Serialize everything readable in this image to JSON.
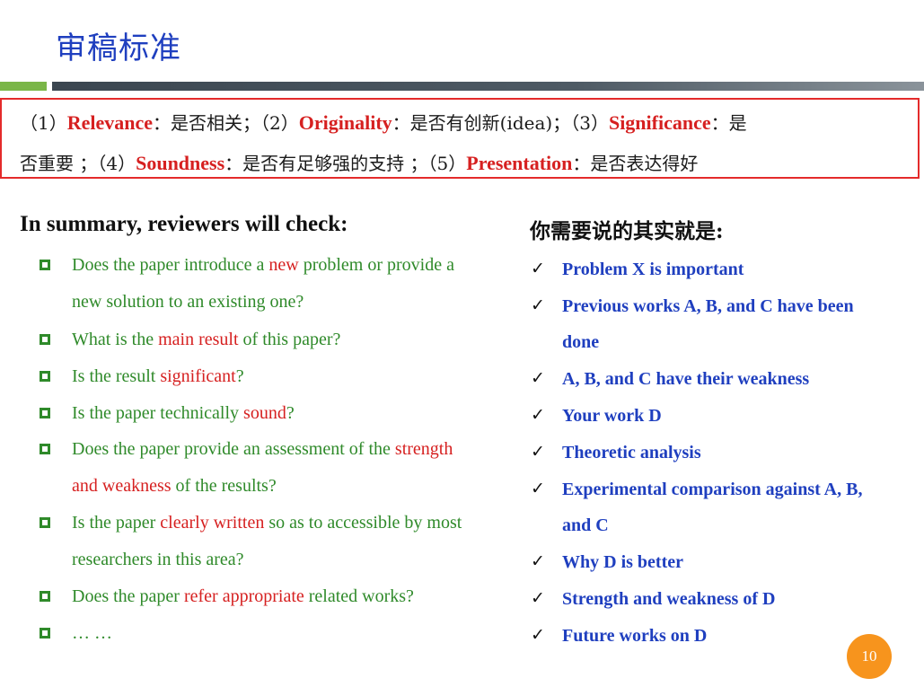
{
  "title": "审稿标准",
  "criteria": {
    "line1": [
      {
        "text": "（1）",
        "kw": false
      },
      {
        "text": "Relevance",
        "kw": true
      },
      {
        "text": "：是否相关；（2）",
        "kw": false
      },
      {
        "text": "Originality",
        "kw": true
      },
      {
        "text": "：是否有创新(idea)；（3）",
        "kw": false
      },
      {
        "text": "Significance",
        "kw": true
      },
      {
        "text": "：是",
        "kw": false
      }
    ],
    "line2": [
      {
        "text": "否重要 ；（4）",
        "kw": false
      },
      {
        "text": "Soundness",
        "kw": true
      },
      {
        "text": "：是否有足够强的支持 ；（5）",
        "kw": false
      },
      {
        "text": "Presentation",
        "kw": true
      },
      {
        "text": "：是否表达得好",
        "kw": false
      }
    ]
  },
  "left_heading": "In summary, reviewers will check:",
  "right_heading": "你需要说的其实就是:",
  "left_items": [
    {
      "bullet": true,
      "parts": [
        {
          "t": "Does the paper introduce a ",
          "r": false
        },
        {
          "t": "new",
          "r": true
        },
        {
          "t": " problem or provide a",
          "r": false
        }
      ]
    },
    {
      "bullet": false,
      "parts": [
        {
          "t": "new solution to an existing one?",
          "r": false
        }
      ]
    },
    {
      "bullet": true,
      "parts": [
        {
          "t": " What is the ",
          "r": false
        },
        {
          "t": "main result",
          "r": true
        },
        {
          "t": " of this paper?",
          "r": false
        }
      ]
    },
    {
      "bullet": true,
      "parts": [
        {
          "t": "Is the result ",
          "r": false
        },
        {
          "t": "significant",
          "r": true
        },
        {
          "t": "?",
          "r": false
        }
      ]
    },
    {
      "bullet": true,
      "parts": [
        {
          "t": "Is the paper technically ",
          "r": false
        },
        {
          "t": "sound",
          "r": true
        },
        {
          "t": "?",
          "r": false
        }
      ]
    },
    {
      "bullet": true,
      "parts": [
        {
          "t": "Does the paper provide an assessment of the ",
          "r": false
        },
        {
          "t": "strength",
          "r": true
        }
      ]
    },
    {
      "bullet": false,
      "parts": [
        {
          "t": "and weakness",
          "r": true
        },
        {
          "t": " of the results?",
          "r": false
        }
      ]
    },
    {
      "bullet": true,
      "parts": [
        {
          "t": "Is the paper ",
          "r": false
        },
        {
          "t": "clearly written",
          "r": true
        },
        {
          "t": " so as to accessible by most",
          "r": false
        }
      ]
    },
    {
      "bullet": false,
      "parts": [
        {
          "t": "researchers in this area?",
          "r": false
        }
      ]
    },
    {
      "bullet": true,
      "parts": [
        {
          "t": "Does the paper ",
          "r": false
        },
        {
          "t": "refer appropriate",
          "r": true
        },
        {
          "t": " related works?",
          "r": false
        }
      ]
    },
    {
      "bullet": true,
      "parts": [
        {
          "t": "… …",
          "r": false
        }
      ]
    }
  ],
  "check_symbol": "✓",
  "right_items": [
    {
      "check": true,
      "text": "Problem X is important"
    },
    {
      "check": true,
      "text": "Previous works A, B, and C have been"
    },
    {
      "check": false,
      "text": "done"
    },
    {
      "check": true,
      "text": " A, B, and C have their weakness"
    },
    {
      "check": true,
      "text": "Your work D"
    },
    {
      "check": true,
      "text": "Theoretic analysis"
    },
    {
      "check": true,
      "text": "Experimental comparison against A, B,"
    },
    {
      "check": false,
      "text": "and C"
    },
    {
      "check": true,
      "text": "Why D is better"
    },
    {
      "check": true,
      "text": "Strength and weakness of D"
    },
    {
      "check": true,
      "text": "Future works on D"
    }
  ],
  "page_number": "10",
  "colors": {
    "title": "#1f3fbf",
    "keyword_red": "#d62020",
    "left_text_green": "#2f8a2a",
    "right_text_blue": "#1f3fbf",
    "box_border": "#e42b2b",
    "page_badge": "#f7941d",
    "accent_green_bar": "#7ab648"
  }
}
